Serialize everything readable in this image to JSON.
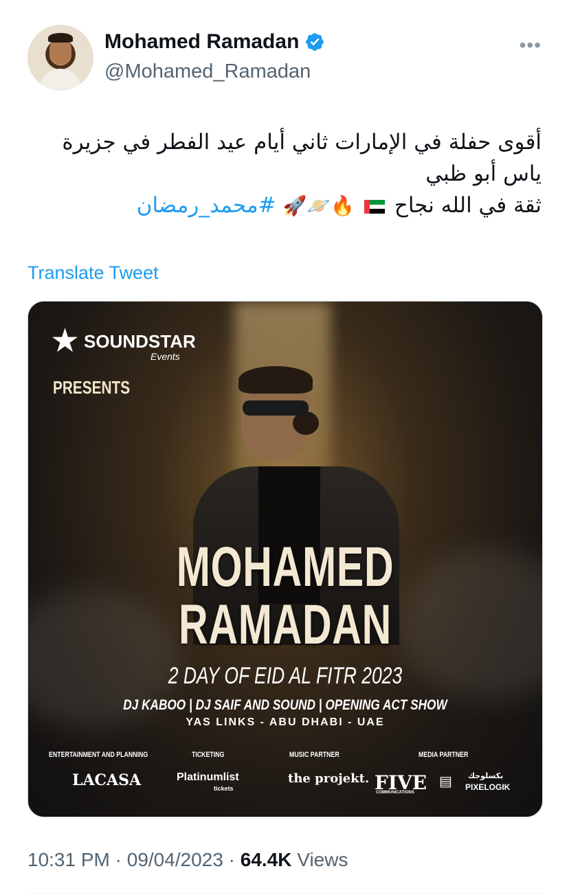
{
  "user": {
    "display_name": "Mohamed Ramadan",
    "handle": "@Mohamed_Ramadan",
    "verified_color": "#1d9bf0"
  },
  "tweet": {
    "line1": "أقوى حفلة في الإمارات ثاني أيام عيد الفطر في جزيرة",
    "line2": "ياس أبو ظبي",
    "line3_text": "ثقة في الله نجاح",
    "line3_emojis": "🔥🪐🚀",
    "hashtag": "#محمد_رمضان",
    "translate_label": "Translate Tweet"
  },
  "poster": {
    "brand": "SOUNDSTAR",
    "brand_sub": "Events",
    "presents": "PRESENTS",
    "title_line1": "MOHAMED",
    "title_line2": "RAMADAN",
    "date": "2 DAY OF EID AL FITR 2023",
    "acts": "DJ KABOO | DJ SAIF AND SOUND | OPENING ACT SHOW",
    "location": "YAS LINKS - ABU DHABI - UAE",
    "partners": [
      {
        "label": "ENTERTAINMENT AND PLANNING",
        "logo": "LACASA"
      },
      {
        "label": "TICKETING",
        "logo": "Platinumlist",
        "logo_sub": "tickets"
      },
      {
        "label": "MUSIC PARTNER",
        "logo": "the projekt."
      },
      {
        "label": "MEDIA PARTNER",
        "logo": "FIVE",
        "logo_sub": "COMMUNICATIONS",
        "logo2": "PIXELOGIK",
        "logo2_ar": "بكسلوجك"
      }
    ]
  },
  "footer": {
    "time": "10:31 PM",
    "separator": "·",
    "date": "09/04/2023",
    "views_count": "64.4K",
    "views_label": "Views"
  },
  "more_icon": "more-dots-icon"
}
